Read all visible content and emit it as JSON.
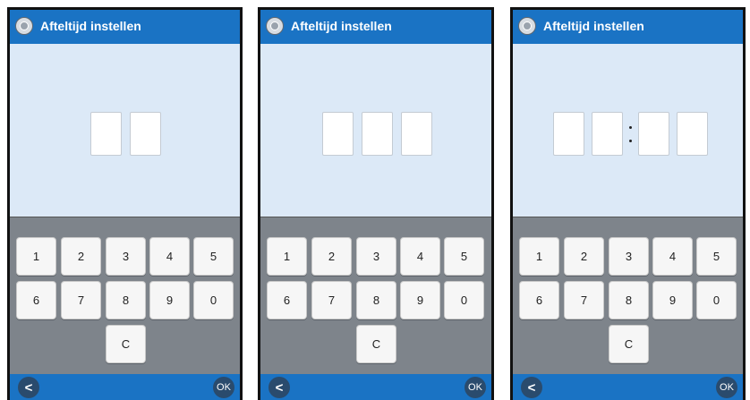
{
  "title": "Afteltijd instellen",
  "icons": {
    "app": "settings-dial-icon",
    "back": "back-arrow-icon"
  },
  "keypad": {
    "row1": [
      "1",
      "2",
      "3",
      "4",
      "5"
    ],
    "row2": [
      "6",
      "7",
      "8",
      "9",
      "0"
    ],
    "clear": "C"
  },
  "nav": {
    "back_label": "<",
    "ok_label": "OK"
  },
  "screens": [
    {
      "digit_count": 2,
      "has_colon": false
    },
    {
      "digit_count": 3,
      "has_colon": false
    },
    {
      "digit_count": 4,
      "has_colon": true
    }
  ],
  "colors": {
    "titlebar": "#1a73c4",
    "display_bg": "#dce9f7",
    "keypad_bg": "#7e848b"
  }
}
